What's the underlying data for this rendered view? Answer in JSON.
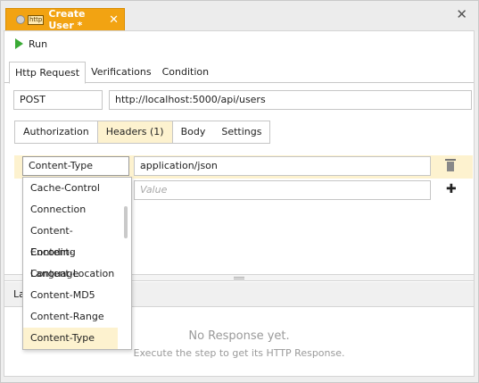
{
  "tab": {
    "icon_label": "http",
    "title": "Create User *",
    "close_glyph": "✕"
  },
  "window_close_glyph": "✕",
  "toolbar": {
    "run_label": "Run"
  },
  "subtabs": [
    {
      "label": "Http Request",
      "active": true
    },
    {
      "label": "Verifications",
      "active": false
    },
    {
      "label": "Condition",
      "active": false
    }
  ],
  "request": {
    "method": "POST",
    "url": "http://localhost:5000/api/users"
  },
  "request_tabs": [
    {
      "label": "Authorization",
      "active": false
    },
    {
      "label": "Headers (1)",
      "active": true
    },
    {
      "label": "Body",
      "active": false
    },
    {
      "label": "Settings",
      "active": false
    }
  ],
  "headers": {
    "rows": [
      {
        "name": "Content-Type",
        "value": "application/json"
      }
    ],
    "new_value_placeholder": "Value"
  },
  "header_name_dropdown": {
    "options": [
      "Cache-Control",
      "Connection",
      "Content-Encoding",
      "Content-Language",
      "Content-Location",
      "Content-MD5",
      "Content-Range",
      "Content-Type"
    ],
    "selected": "Content-Type"
  },
  "response": {
    "header_label_partial": "La",
    "empty_title": "No Response yet.",
    "empty_hint": "Execute the step to get its HTTP Response."
  }
}
